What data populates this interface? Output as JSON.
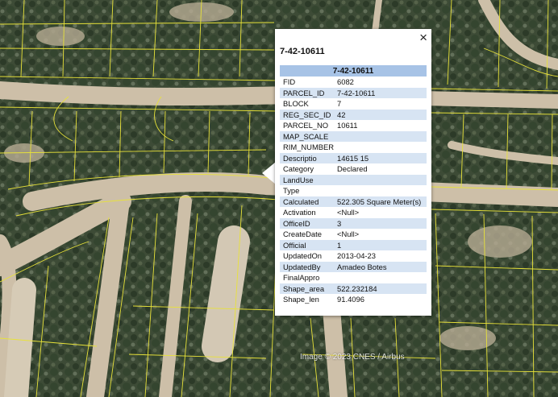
{
  "map": {
    "attribution": "Image © 2023 CNES / Airbus",
    "parcel_line_color": "#e8e23a",
    "road_color": "#cdbfa8"
  },
  "balloon": {
    "close_icon": "×",
    "title": "7-42-10611",
    "table_header": "7-42-10611",
    "rows": [
      {
        "key": "FID",
        "value": "6082"
      },
      {
        "key": "PARCEL_ID",
        "value": "7-42-10611"
      },
      {
        "key": "BLOCK",
        "value": "7"
      },
      {
        "key": "REG_SEC_ID",
        "value": "42"
      },
      {
        "key": "PARCEL_NO",
        "value": "10611"
      },
      {
        "key": "MAP_SCALE",
        "value": ""
      },
      {
        "key": "RIM_NUMBER",
        "value": ""
      },
      {
        "key": "Descriptio",
        "value": "14615 15"
      },
      {
        "key": "Category",
        "value": "Declared"
      },
      {
        "key": "LandUse",
        "value": ""
      },
      {
        "key": "Type",
        "value": ""
      },
      {
        "key": "Calculated",
        "value": "522.305 Square Meter(s)"
      },
      {
        "key": "Activation",
        "value": "<Null>"
      },
      {
        "key": "OfficeID",
        "value": "3"
      },
      {
        "key": "CreateDate",
        "value": "<Null>"
      },
      {
        "key": "Official",
        "value": "1"
      },
      {
        "key": "UpdatedOn",
        "value": "2013-04-23"
      },
      {
        "key": "UpdatedBy",
        "value": "Amadeo Botes"
      },
      {
        "key": "FinalAppro",
        "value": ""
      },
      {
        "key": "Shape_area",
        "value": "522.232184"
      },
      {
        "key": "Shape_len",
        "value": "91.4096"
      }
    ],
    "header_color": "#a7c3e6",
    "alt_row_color": "#d7e4f3"
  }
}
